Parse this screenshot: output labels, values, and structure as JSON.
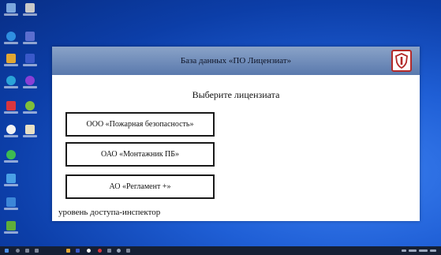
{
  "window": {
    "title": "База данных «ПО Лицензиат»",
    "prompt": "Выберите лицензиата",
    "licensees": [
      "ООО «Пожарная безопасность»",
      "ОАО «Монтажник ПБ»",
      "АО «Регламент +»"
    ],
    "access_level": "уровень доступа-инспектор"
  },
  "desktop_icons": [
    "computer-icon",
    "user-folder-icon",
    "edge-icon",
    "network-icon",
    "chrome-icon",
    "onedrive-icon",
    "steam-icon",
    "media-player-icon",
    "recycle-bin-icon",
    "folder-icon",
    "yandex-icon",
    "notes-icon",
    "whatsapp-icon",
    "telegram-icon",
    "settings-icon",
    "game-icon"
  ],
  "colors": {
    "titlebar": "#5a79ad",
    "logo_red": "#b22a2a",
    "taskbar": "#151f34"
  }
}
